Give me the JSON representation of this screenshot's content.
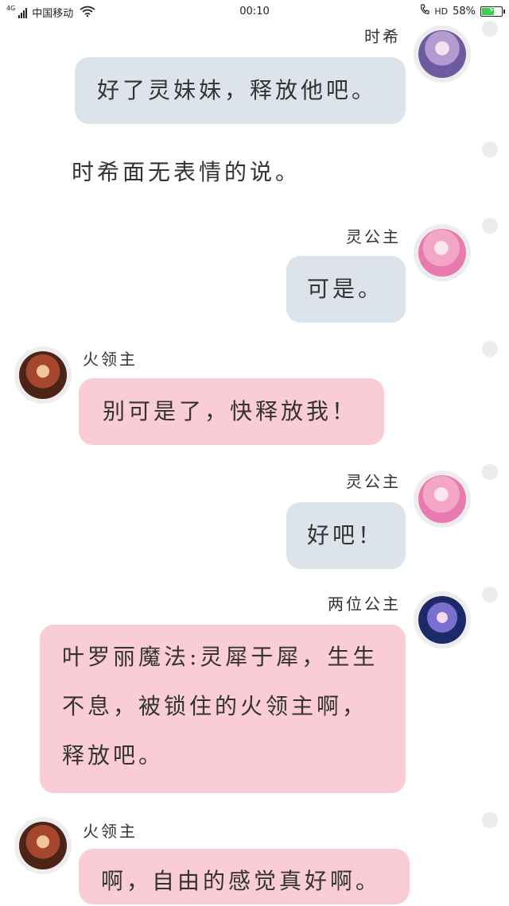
{
  "status": {
    "network": "4G",
    "carrier": "中国移动",
    "time": "00:10",
    "hd": "HD",
    "battery": "58%",
    "battery_level": 0.58,
    "battery_color": "#3ccf4e"
  },
  "colors": {
    "bubble_grey": "#dce3ea",
    "bubble_pink": "#f9ccd6"
  },
  "messages": [
    {
      "speaker": "时希",
      "text": "好了灵妹妹，释放他吧。"
    },
    {
      "narration": "时希面无表情的说。"
    },
    {
      "speaker": "灵公主",
      "text": "可是。"
    },
    {
      "speaker": "火领主",
      "text": "别可是了，快释放我！"
    },
    {
      "speaker": "灵公主",
      "text": "好吧！"
    },
    {
      "speaker": "两位公主",
      "lines": [
        "叶罗丽魔法:灵犀于犀，生生",
        "不息，被锁住的火领主啊，",
        "释放吧。"
      ]
    },
    {
      "speaker": "火领主",
      "text": "啊，自由的感觉真好啊。"
    }
  ]
}
